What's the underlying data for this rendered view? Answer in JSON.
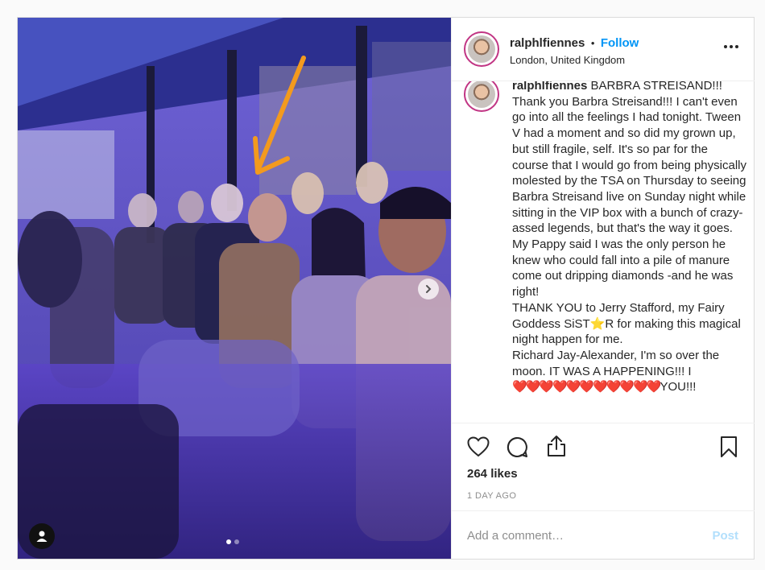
{
  "header": {
    "username": "ralphlfiennes",
    "separator": "•",
    "follow_label": "Follow",
    "location": "London, United Kingdom",
    "more_icon": "more-options-icon"
  },
  "caption": {
    "username": "ralphlfiennes",
    "first_line": "BARBRA STREISAND!!!",
    "paragraphs": [
      "Thank you Barbra Streisand!!! I can't even go into all the feelings I had tonight. Tween V had a moment and so did my grown up, but still fragile, self. It's so par for the course that I would go from being physically molested by the TSA on Thursday to seeing Barbra Streisand live on Sunday night while sitting in the VIP box with a bunch of crazy-assed legends, but that's the way it goes.",
      "My Pappy said I was the only person he knew who could fall into a pile of manure come out dripping diamonds -and he was right!",
      "THANK YOU to Jerry Stafford, my Fairy Goddess SiST⭐R for making this magical night happen for me.",
      "Richard Jay-Alexander, I'm so over the moon. IT WAS A HAPPENING!!! I"
    ],
    "hearts": "❤️❤️❤️❤️❤️❤️❤️❤️❤️❤️❤️",
    "hearts_tail": "YOU!!!"
  },
  "actions": {
    "likes": "264 likes",
    "timestamp": "1 DAY AGO",
    "icons": [
      "heart-icon",
      "comment-icon",
      "share-icon",
      "bookmark-icon"
    ]
  },
  "comment_box": {
    "placeholder": "Add a comment…",
    "post_label": "Post"
  },
  "carousel": {
    "slide_count": 2,
    "active_index": 0
  },
  "colors": {
    "follow": "#0095f6",
    "post_disabled": "#b2dffc",
    "annotation_arrow": "#f39a1e"
  }
}
